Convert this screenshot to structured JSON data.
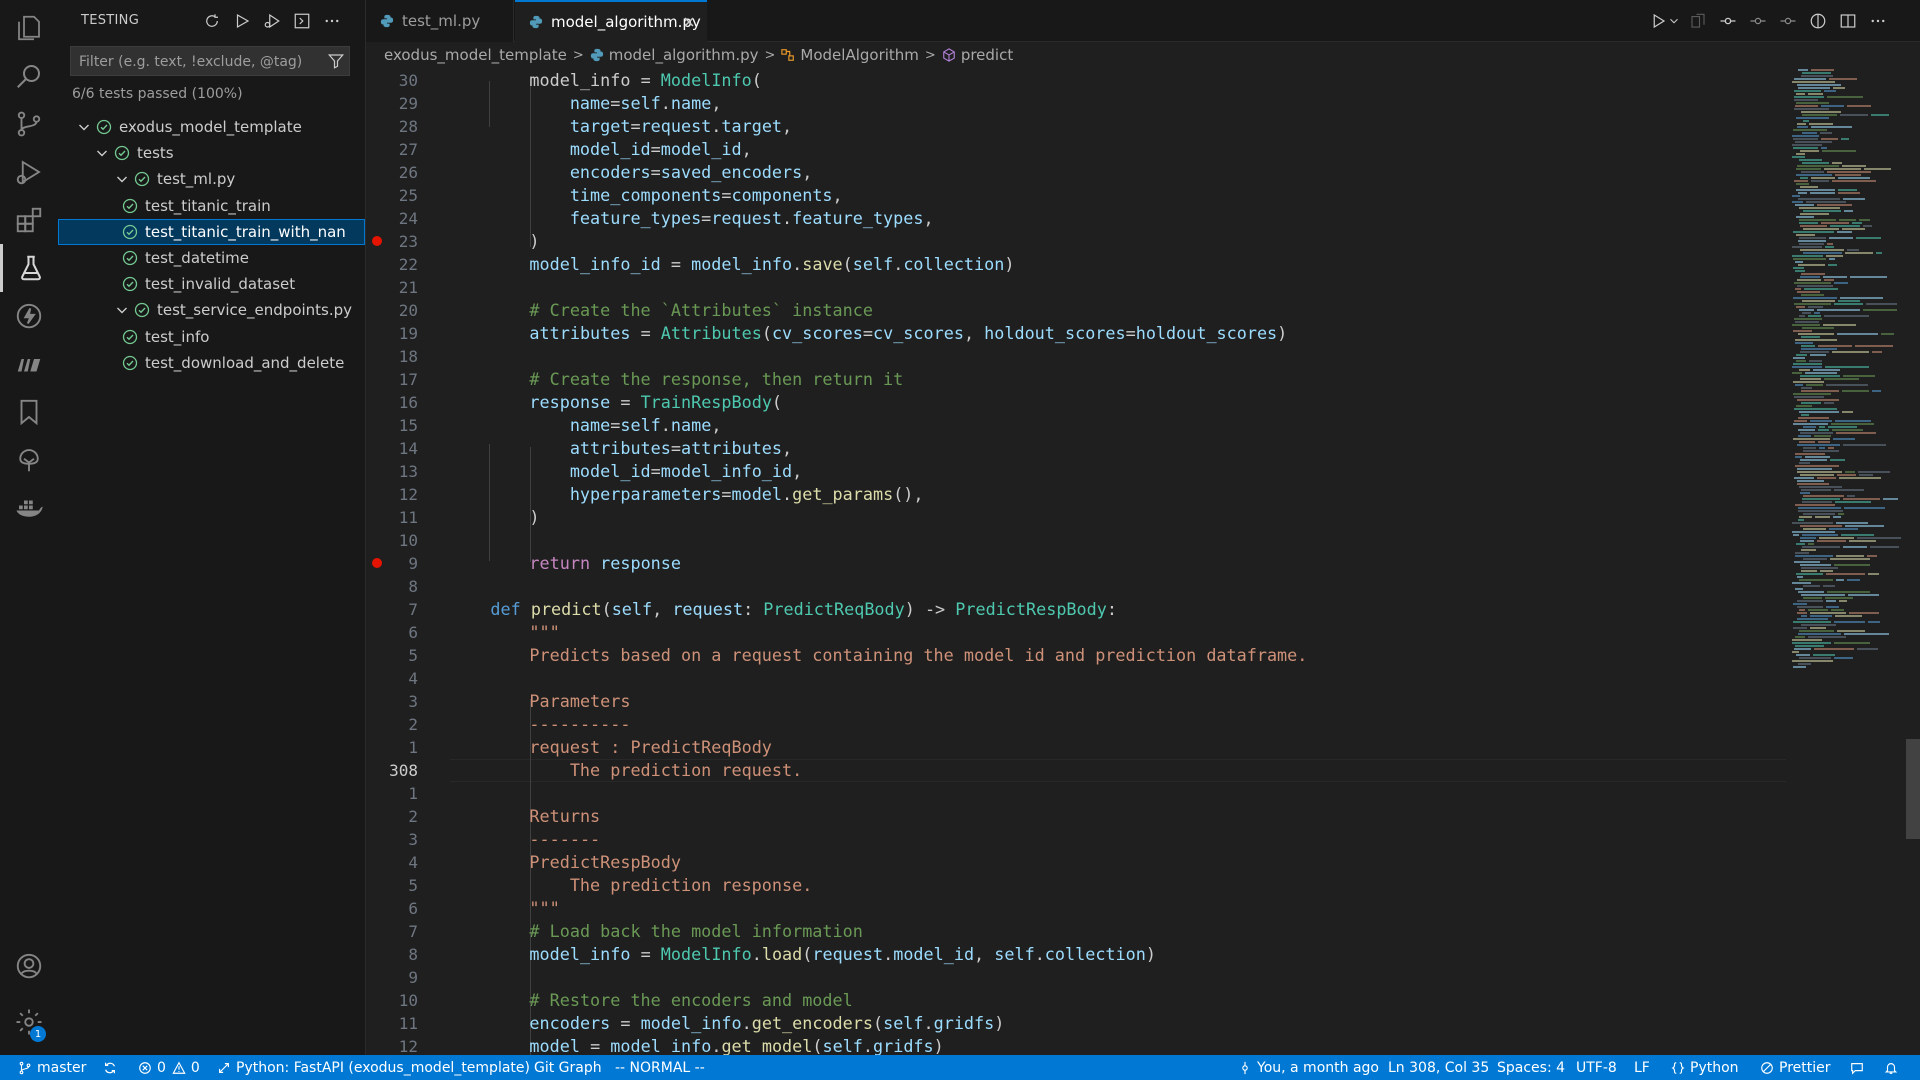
{
  "activity_bar": {
    "items": [
      "explorer-icon",
      "search-icon",
      "source-control-icon",
      "run-debug-icon",
      "extensions-icon",
      "testing-icon",
      "thunder-client-icon",
      "mongodb-icon",
      "bookmarks-icon",
      "tree-icon",
      "docker-icon"
    ],
    "bottom": [
      "account-icon",
      "manage-gear-icon"
    ],
    "settings_badge": "1"
  },
  "sidebar": {
    "title": "TESTING",
    "filter_placeholder": "Filter (e.g. text, !exclude, @tag)",
    "summary": "6/6 tests passed (100%)",
    "tree": [
      {
        "label": "exodus_model_template",
        "depth": 0,
        "expandable": true
      },
      {
        "label": "tests",
        "depth": 1,
        "expandable": true
      },
      {
        "label": "test_ml.py",
        "depth": 2,
        "expandable": true
      },
      {
        "label": "test_titanic_train",
        "depth": 3,
        "expandable": false
      },
      {
        "label": "test_titanic_train_with_nan",
        "depth": 3,
        "expandable": false,
        "selected": true
      },
      {
        "label": "test_datetime",
        "depth": 3,
        "expandable": false
      },
      {
        "label": "test_invalid_dataset",
        "depth": 3,
        "expandable": false
      },
      {
        "label": "test_service_endpoints.py",
        "depth": 2,
        "expandable": true
      },
      {
        "label": "test_info",
        "depth": 3,
        "expandable": false
      },
      {
        "label": "test_download_and_delete",
        "depth": 3,
        "expandable": false
      }
    ]
  },
  "tabs": [
    {
      "label": "test_ml.py",
      "active": false
    },
    {
      "label": "model_algorithm.py",
      "active": true
    }
  ],
  "breadcrumb": [
    "exodus_model_template",
    "model_algorithm.py",
    "ModelAlgorithm",
    "predict"
  ],
  "editor": {
    "current_line": "308",
    "line_numbers": [
      "30",
      "29",
      "28",
      "27",
      "26",
      "25",
      "24",
      "23",
      "22",
      "21",
      "20",
      "19",
      "18",
      "17",
      "16",
      "15",
      "14",
      "13",
      "12",
      "11",
      "10",
      "9",
      "8",
      "7",
      "6",
      "5",
      "4",
      "3",
      "2",
      "1",
      "308",
      "1",
      "2",
      "3",
      "4",
      "5",
      "6",
      "7",
      "8",
      "9",
      "10",
      "11",
      "12"
    ],
    "breakpoint_lines": [
      "23",
      "9"
    ]
  },
  "status_bar": {
    "branch": "master",
    "problems": "0",
    "warnings": "0",
    "interpreter": "Python: FastAPI (exodus_model_template)",
    "git_graph": "Git Graph",
    "vim_mode": "-- NORMAL --",
    "blame": "You, a month ago",
    "cursor": "Ln 308, Col 35",
    "spaces": "Spaces: 4",
    "encoding": "UTF-8",
    "eol": "LF",
    "language": "Python",
    "formatter": "Prettier"
  },
  "colors": {
    "accent": "#0078d4",
    "pass": "#73c991",
    "breakpoint": "#e51400",
    "keyword": "#569cd6",
    "function": "#dcdcaa",
    "class": "#4ec9b0",
    "string": "#ce9178",
    "comment": "#6a9955",
    "variable": "#9cdcfe"
  }
}
